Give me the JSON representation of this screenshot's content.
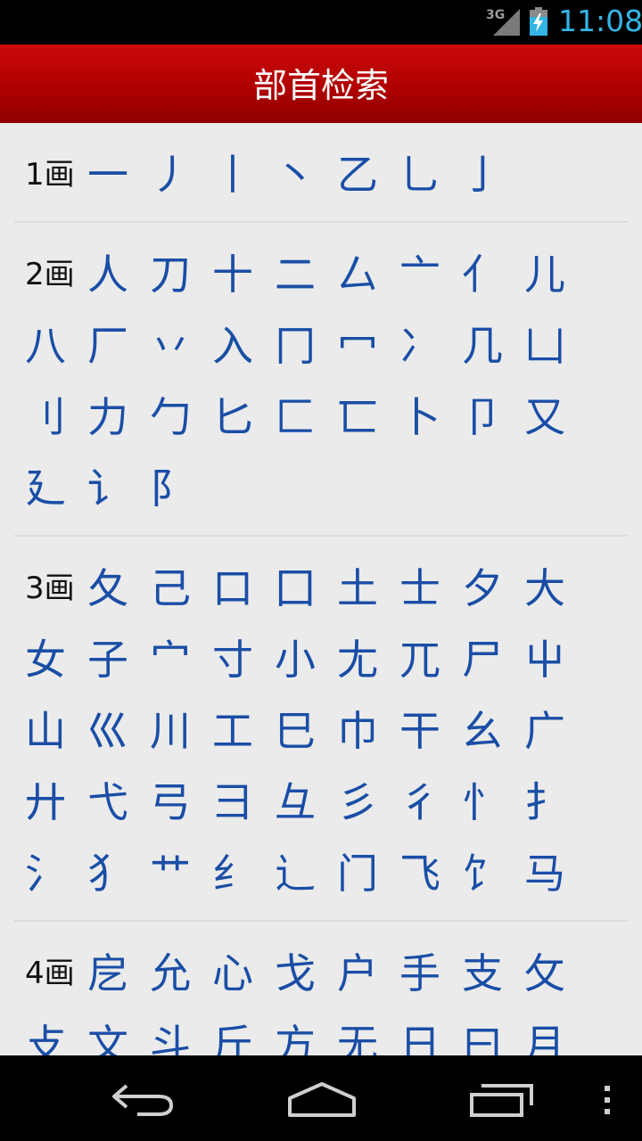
{
  "status_bar": {
    "network": "3G",
    "time": "11:08"
  },
  "title": "部首检索",
  "groups": [
    {
      "label": "1画",
      "radicals": [
        "一",
        "丿",
        "丨",
        "丶",
        "乙",
        "乚",
        "亅"
      ]
    },
    {
      "label": "2画",
      "radicals": [
        "人",
        "刀",
        "十",
        "二",
        "厶",
        "亠",
        "亻",
        "儿",
        "八",
        "厂",
        "丷",
        "入",
        "冂",
        "冖",
        "冫",
        "几",
        "凵",
        "刂",
        "力",
        "勹",
        "匕",
        "匚",
        "匸",
        "卜",
        "卩",
        "又",
        "廴",
        "讠",
        "阝"
      ]
    },
    {
      "label": "3画",
      "radicals": [
        "夂",
        "己",
        "口",
        "囗",
        "土",
        "士",
        "夕",
        "大",
        "女",
        "子",
        "宀",
        "寸",
        "小",
        "尢",
        "兀",
        "尸",
        "屮",
        "山",
        "巛",
        "川",
        "工",
        "巳",
        "巾",
        "干",
        "幺",
        "广",
        "廾",
        "弋",
        "弓",
        "彐",
        "彑",
        "彡",
        "彳",
        "忄",
        "扌",
        "氵",
        "犭",
        "艹",
        "纟",
        "辶",
        "门",
        "飞",
        "饣",
        "马"
      ]
    },
    {
      "label": "4画",
      "radicals": [
        "戹",
        "允",
        "心",
        "戈",
        "户",
        "手",
        "支",
        "攵",
        "攴",
        "文",
        "斗",
        "斤",
        "方",
        "无",
        "日",
        "曰",
        "月"
      ]
    }
  ],
  "icons": {
    "back": "back-icon",
    "home": "home-icon",
    "recent": "recent-apps-icon",
    "menu": "overflow-menu-icon"
  }
}
